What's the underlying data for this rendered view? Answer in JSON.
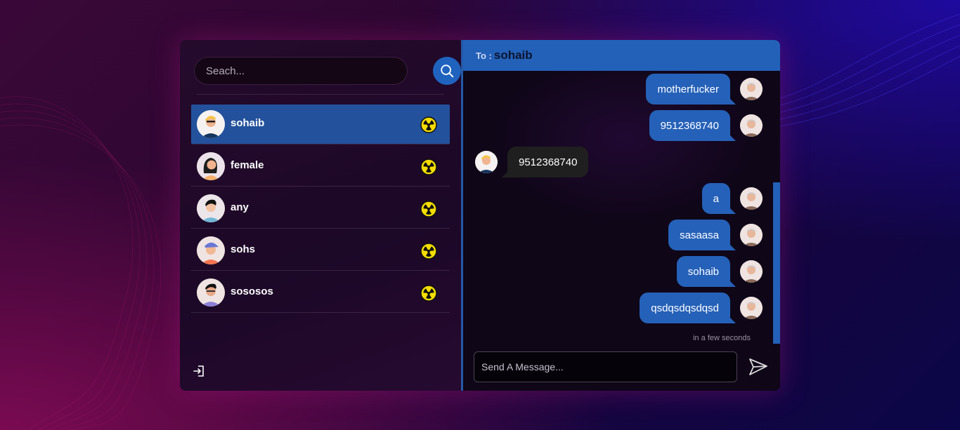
{
  "search": {
    "placeholder": "Seach..."
  },
  "contacts": [
    {
      "name": "sohaib",
      "active": true,
      "avatar": "man-blonde-avatar",
      "status_icon": "radiation-icon"
    },
    {
      "name": "female",
      "active": false,
      "avatar": "woman-avatar",
      "status_icon": "radiation-icon"
    },
    {
      "name": "any",
      "active": false,
      "avatar": "man-dark-hair-avatar",
      "status_icon": "radiation-icon"
    },
    {
      "name": "sohs",
      "active": false,
      "avatar": "man-cap-avatar",
      "status_icon": "radiation-icon"
    },
    {
      "name": "sososos",
      "active": false,
      "avatar": "man-glasses-avatar",
      "status_icon": "radiation-icon"
    }
  ],
  "chat": {
    "to_label": "To :",
    "to_name": "sohaib",
    "messages": [
      {
        "text": "motherfucker",
        "direction": "sent"
      },
      {
        "text": "9512368740",
        "direction": "sent"
      },
      {
        "text": "9512368740",
        "direction": "received"
      },
      {
        "text": "a",
        "direction": "sent"
      },
      {
        "text": "sasaasa",
        "direction": "sent"
      },
      {
        "text": "sohaib",
        "direction": "sent"
      },
      {
        "text": "qsdqsdqsdqsd",
        "direction": "sent"
      }
    ],
    "last_timestamp": "in a few seconds"
  },
  "composer": {
    "placeholder": "Send A Message..."
  },
  "icons": {
    "search": "search-icon",
    "logout": "logout-icon",
    "send": "send-icon",
    "status": "radiation-icon"
  },
  "colors": {
    "accent": "#2360b8",
    "active_row": "#23519c",
    "status_yellow": "#f5dd00"
  }
}
